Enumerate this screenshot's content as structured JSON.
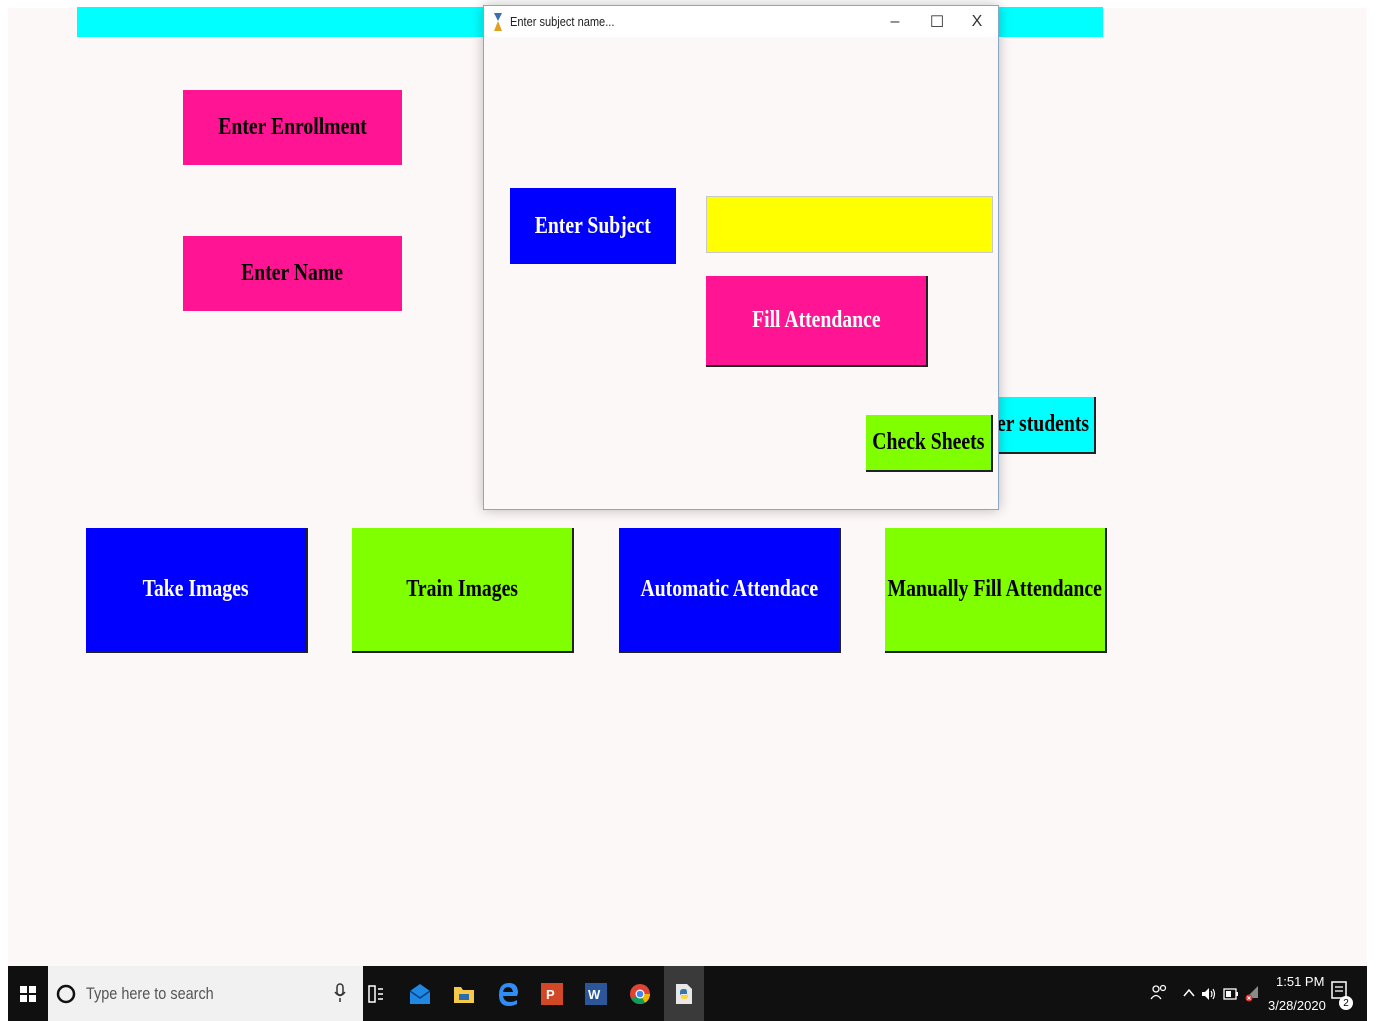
{
  "main": {
    "enroll_label": "Enter Enrollment",
    "name_label": "Enter Name",
    "register_partial": "er students",
    "take_images": "Take Images",
    "train_images": "Train Images",
    "auto_attendance": "Automatic Attendace",
    "manual_attendance": "Manually Fill Attendance"
  },
  "dialog": {
    "title": "Enter subject name...",
    "minimize": "–",
    "maximize": "☐",
    "close": "X",
    "subject_label": "Enter Subject",
    "subject_value": "",
    "fill_button": "Fill Attendance",
    "check_button": "Check Sheets"
  },
  "taskbar": {
    "search_placeholder": "Type here to search",
    "time": "1:51 PM",
    "date": "3/28/2020",
    "notification_count": "2"
  },
  "colors": {
    "deep_pink": "#ff1493",
    "blue": "#0000ff",
    "chartreuse": "#7fff00",
    "yellow": "#ffff00",
    "cyan": "#00ffff"
  }
}
